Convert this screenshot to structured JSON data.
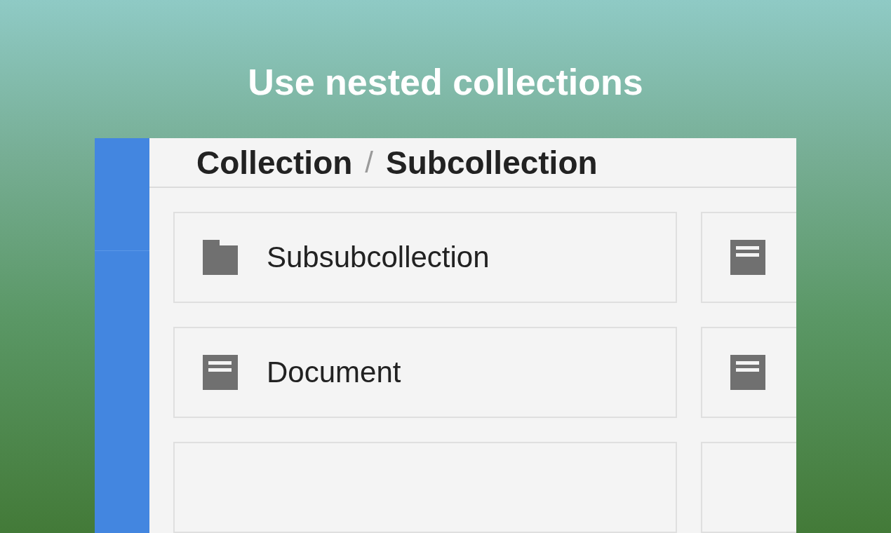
{
  "headline": "Use nested collections",
  "breadcrumb": [
    {
      "label": "Collection"
    },
    {
      "label": "Subcollection"
    }
  ],
  "separator": "/",
  "items": [
    {
      "kind": "folder",
      "label": "Subsubcollection"
    },
    {
      "kind": "document"
    },
    {
      "kind": "document",
      "label": "Document"
    },
    {
      "kind": "document"
    },
    {
      "kind": "blank"
    },
    {
      "kind": "blank"
    }
  ]
}
